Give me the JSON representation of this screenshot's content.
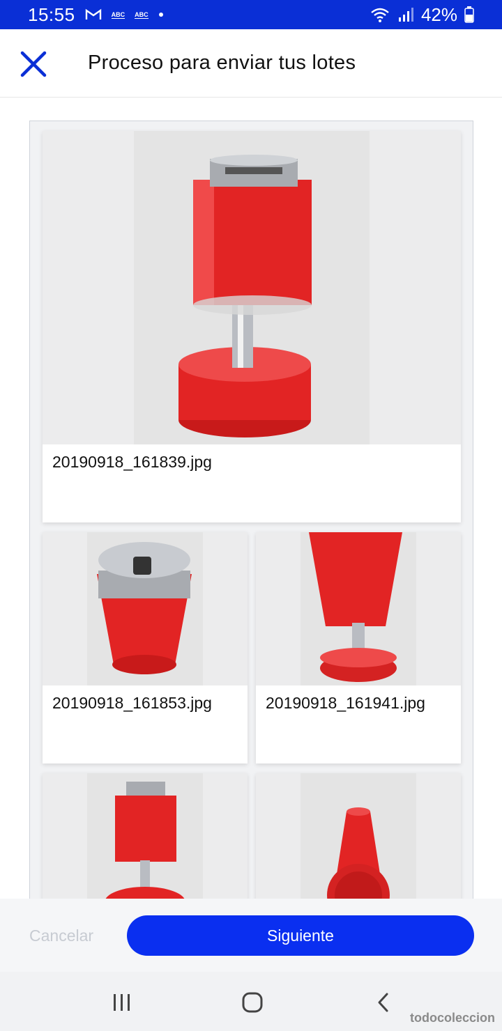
{
  "status_bar": {
    "time": "15:55",
    "notification_icons": [
      "gmail-icon",
      "abc-news-icon",
      "abc-news-icon",
      "dot-icon"
    ],
    "abc_label_1": "ABC",
    "abc_label_2": "ABC",
    "battery_percent": "42%",
    "colors": {
      "background": "#0a2fd6"
    }
  },
  "header": {
    "title": "Proceso para enviar tus lotes",
    "close_icon": "close-icon",
    "colors": {
      "accent": "#0a2fd6"
    }
  },
  "gallery": {
    "items": [
      {
        "filename": "20190918_161839.jpg"
      },
      {
        "filename": "20190918_161853.jpg"
      },
      {
        "filename": "20190918_161941.jpg"
      },
      {
        "filename": ""
      },
      {
        "filename": ""
      }
    ]
  },
  "footer": {
    "cancel_label": "Cancelar",
    "next_label": "Siguiente",
    "colors": {
      "primary": "#0a2ff0",
      "disabled_text": "#c7cbd2"
    }
  },
  "system_nav": {
    "buttons": [
      "recents-icon",
      "home-icon",
      "back-icon"
    ]
  },
  "watermark": "todocoleccion"
}
